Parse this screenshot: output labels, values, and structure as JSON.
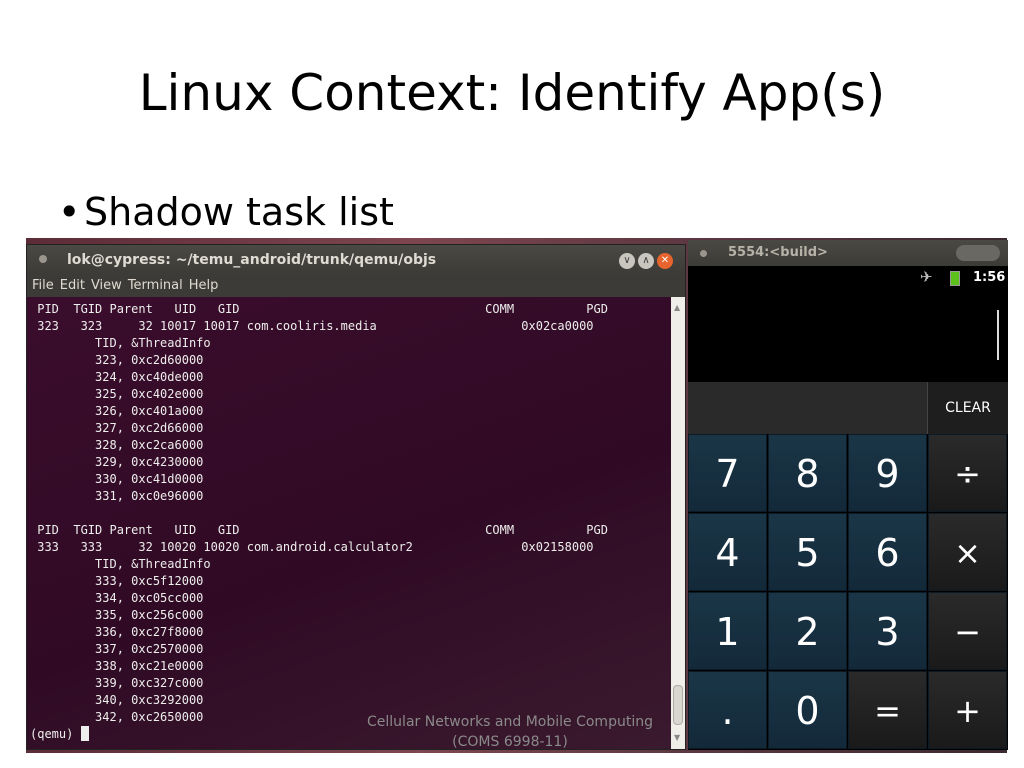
{
  "slide": {
    "title": "Linux Context: Identify App(s)",
    "bullet": "Shadow task list",
    "footer_line1": "Cellular Networks and Mobile Computing",
    "footer_line2": "(COMS 6998-11)"
  },
  "terminal": {
    "title": "lok@cypress: ~/temu_android/trunk/qemu/objs",
    "menu": [
      "File",
      "Edit",
      "View",
      "Terminal",
      "Help"
    ],
    "output": " PID  TGID Parent   UID   GID                                  COMM          PGD\n 323   323     32 10017 10017 com.cooliris.media                    0x02ca0000\n         TID, &ThreadInfo\n         323, 0xc2d60000\n         324, 0xc40de000\n         325, 0xc402e000\n         326, 0xc401a000\n         327, 0xc2d66000\n         328, 0xc2ca6000\n         329, 0xc4230000\n         330, 0xc41d0000\n         331, 0xc0e96000\n\n PID  TGID Parent   UID   GID                                  COMM          PGD\n 333   333     32 10020 10020 com.android.calculator2               0x02158000\n         TID, &ThreadInfo\n         333, 0xc5f12000\n         334, 0xc05cc000\n         335, 0xc256c000\n         336, 0xc27f8000\n         337, 0xc2570000\n         338, 0xc21e0000\n         339, 0xc327c000\n         340, 0xc3292000\n         342, 0xc2650000",
    "prompt": "(qemu) "
  },
  "emulator": {
    "title": "5554:<build>",
    "time": "1:56",
    "display": "",
    "clear_label": "CLEAR",
    "keys": [
      "7",
      "8",
      "9",
      "÷",
      "4",
      "5",
      "6",
      "×",
      "1",
      "2",
      "3",
      "−",
      ".",
      "0",
      "=",
      "+"
    ]
  }
}
